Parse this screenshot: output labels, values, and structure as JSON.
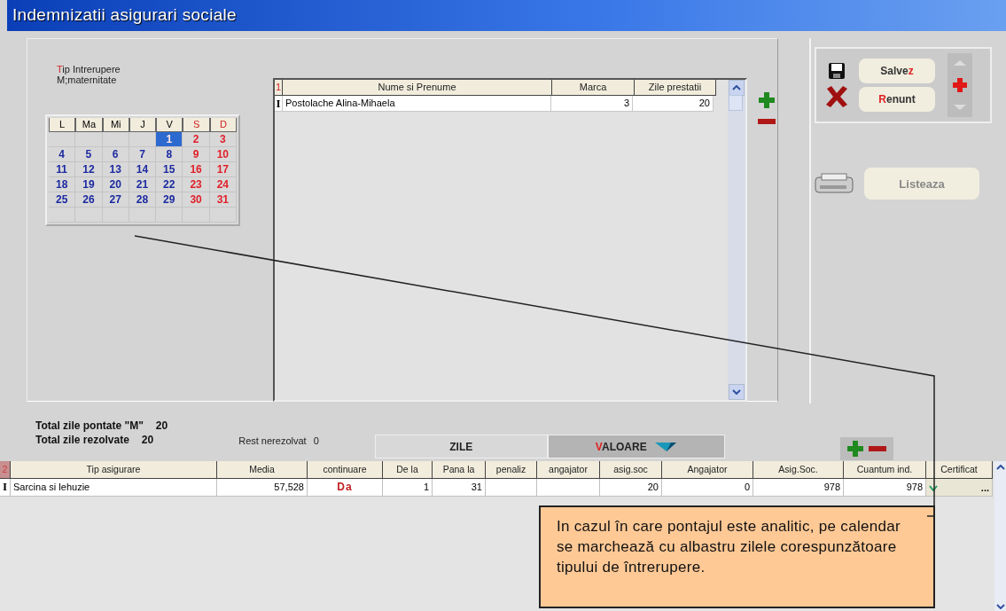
{
  "window": {
    "title": "Indemnizatii asigurari sociale"
  },
  "interruption": {
    "label": [
      {
        "text": "T",
        "accent": true
      },
      {
        "text": "ip Intrerupere",
        "accent": false
      }
    ],
    "value": "M;maternitate"
  },
  "calendar": {
    "headers": [
      {
        "label": "L",
        "weekend": false
      },
      {
        "label": "Ma",
        "weekend": false
      },
      {
        "label": "Mi",
        "weekend": false
      },
      {
        "label": "J",
        "weekend": false
      },
      {
        "label": "V",
        "weekend": false
      },
      {
        "label": "S",
        "weekend": true
      },
      {
        "label": "D",
        "weekend": true
      }
    ],
    "cells": [
      {
        "kind": "blank"
      },
      {
        "kind": "blank"
      },
      {
        "kind": "blank"
      },
      {
        "kind": "blank"
      },
      {
        "kind": "day",
        "day": "1",
        "weekend": false,
        "marked": true
      },
      {
        "kind": "day",
        "day": "2",
        "weekend": true,
        "marked": false
      },
      {
        "kind": "day",
        "day": "3",
        "weekend": true,
        "marked": false
      },
      {
        "kind": "day",
        "day": "4",
        "weekend": false,
        "marked": false
      },
      {
        "kind": "day",
        "day": "5",
        "weekend": false,
        "marked": false
      },
      {
        "kind": "day",
        "day": "6",
        "weekend": false,
        "marked": false
      },
      {
        "kind": "day",
        "day": "7",
        "weekend": false,
        "marked": false
      },
      {
        "kind": "day",
        "day": "8",
        "weekend": false,
        "marked": false
      },
      {
        "kind": "day",
        "day": "9",
        "weekend": true,
        "marked": false
      },
      {
        "kind": "day",
        "day": "10",
        "weekend": true,
        "marked": false
      },
      {
        "kind": "day",
        "day": "11",
        "weekend": false,
        "marked": false
      },
      {
        "kind": "day",
        "day": "12",
        "weekend": false,
        "marked": false
      },
      {
        "kind": "day",
        "day": "13",
        "weekend": false,
        "marked": false
      },
      {
        "kind": "day",
        "day": "14",
        "weekend": false,
        "marked": false
      },
      {
        "kind": "day",
        "day": "15",
        "weekend": false,
        "marked": false
      },
      {
        "kind": "day",
        "day": "16",
        "weekend": true,
        "marked": false
      },
      {
        "kind": "day",
        "day": "17",
        "weekend": true,
        "marked": false
      },
      {
        "kind": "day",
        "day": "18",
        "weekend": false,
        "marked": false
      },
      {
        "kind": "day",
        "day": "19",
        "weekend": false,
        "marked": false
      },
      {
        "kind": "day",
        "day": "20",
        "weekend": false,
        "marked": false
      },
      {
        "kind": "day",
        "day": "21",
        "weekend": false,
        "marked": false
      },
      {
        "kind": "day",
        "day": "22",
        "weekend": false,
        "marked": false
      },
      {
        "kind": "day",
        "day": "23",
        "weekend": true,
        "marked": false
      },
      {
        "kind": "day",
        "day": "24",
        "weekend": true,
        "marked": false
      },
      {
        "kind": "day",
        "day": "25",
        "weekend": false,
        "marked": false
      },
      {
        "kind": "day",
        "day": "26",
        "weekend": false,
        "marked": false
      },
      {
        "kind": "day",
        "day": "27",
        "weekend": false,
        "marked": false
      },
      {
        "kind": "day",
        "day": "28",
        "weekend": false,
        "marked": false
      },
      {
        "kind": "day",
        "day": "29",
        "weekend": false,
        "marked": false
      },
      {
        "kind": "day",
        "day": "30",
        "weekend": true,
        "marked": false
      },
      {
        "kind": "day",
        "day": "31",
        "weekend": true,
        "marked": false
      },
      {
        "kind": "blank"
      },
      {
        "kind": "blank"
      },
      {
        "kind": "blank"
      },
      {
        "kind": "blank"
      },
      {
        "kind": "blank"
      },
      {
        "kind": "blank"
      },
      {
        "kind": "blank"
      }
    ]
  },
  "employees": {
    "marker": "1",
    "columns": [
      {
        "label": "Nume si Prenume",
        "kind": "text"
      },
      {
        "label": "Marca",
        "kind": "number"
      },
      {
        "label": "Zile prestatii",
        "kind": "number"
      }
    ],
    "rows": [
      {
        "marker": "I",
        "cells": [
          "Postolache Alina-Mihaela",
          "3",
          "20"
        ]
      }
    ]
  },
  "actions": {
    "save": [
      {
        "text": "Salve",
        "accent": false
      },
      {
        "text": "z",
        "accent": true
      }
    ],
    "cancel": [
      {
        "text": "R",
        "accent": true
      },
      {
        "text": "enunt",
        "accent": false
      }
    ],
    "list": "Listeaza"
  },
  "totals": [
    {
      "label": "Total zile pontate  \"M\"",
      "value": "20"
    },
    {
      "label": "Total zile rezolvate",
      "value": "20"
    }
  ],
  "rest": {
    "label": "Rest nerezolvat",
    "value": "0"
  },
  "tabs": [
    {
      "label": [
        {
          "text": "ZILE",
          "accent": false
        }
      ],
      "selected": false,
      "dropdown": false
    },
    {
      "label": [
        {
          "text": "V",
          "accent": true
        },
        {
          "text": "ALOARE",
          "accent": false
        }
      ],
      "selected": true,
      "dropdown": true
    }
  ],
  "insurance": {
    "marker": "2",
    "columns": [
      {
        "label": "Tip asigurare",
        "kind": "text"
      },
      {
        "label": "Media",
        "kind": "number"
      },
      {
        "label": "continuare",
        "kind": "flag"
      },
      {
        "label": "De la",
        "kind": "number"
      },
      {
        "label": "Pana la",
        "kind": "number"
      },
      {
        "label": "penaliz",
        "kind": "number"
      },
      {
        "label": "angajator",
        "kind": "number"
      },
      {
        "label": "asig.soc",
        "kind": "number"
      },
      {
        "label": "Angajator",
        "kind": "number"
      },
      {
        "label": "Asig.Soc.",
        "kind": "number"
      },
      {
        "label": "Cuantum ind.",
        "kind": "number"
      },
      {
        "label": "Certificat",
        "kind": "certificate"
      }
    ],
    "rows": [
      {
        "marker": "I",
        "cells": [
          "Sarcina si lehuzie",
          "57,528",
          "Da",
          "1",
          "31",
          null,
          null,
          "20",
          "0",
          "978",
          "978"
        ],
        "certificate": {
          "checked": true,
          "more": "..."
        }
      }
    ]
  },
  "note": "In cazul în care pontajul este analitic, pe calendar se marchează cu albastru zilele corespunzătoare tipului de întrerupere."
}
